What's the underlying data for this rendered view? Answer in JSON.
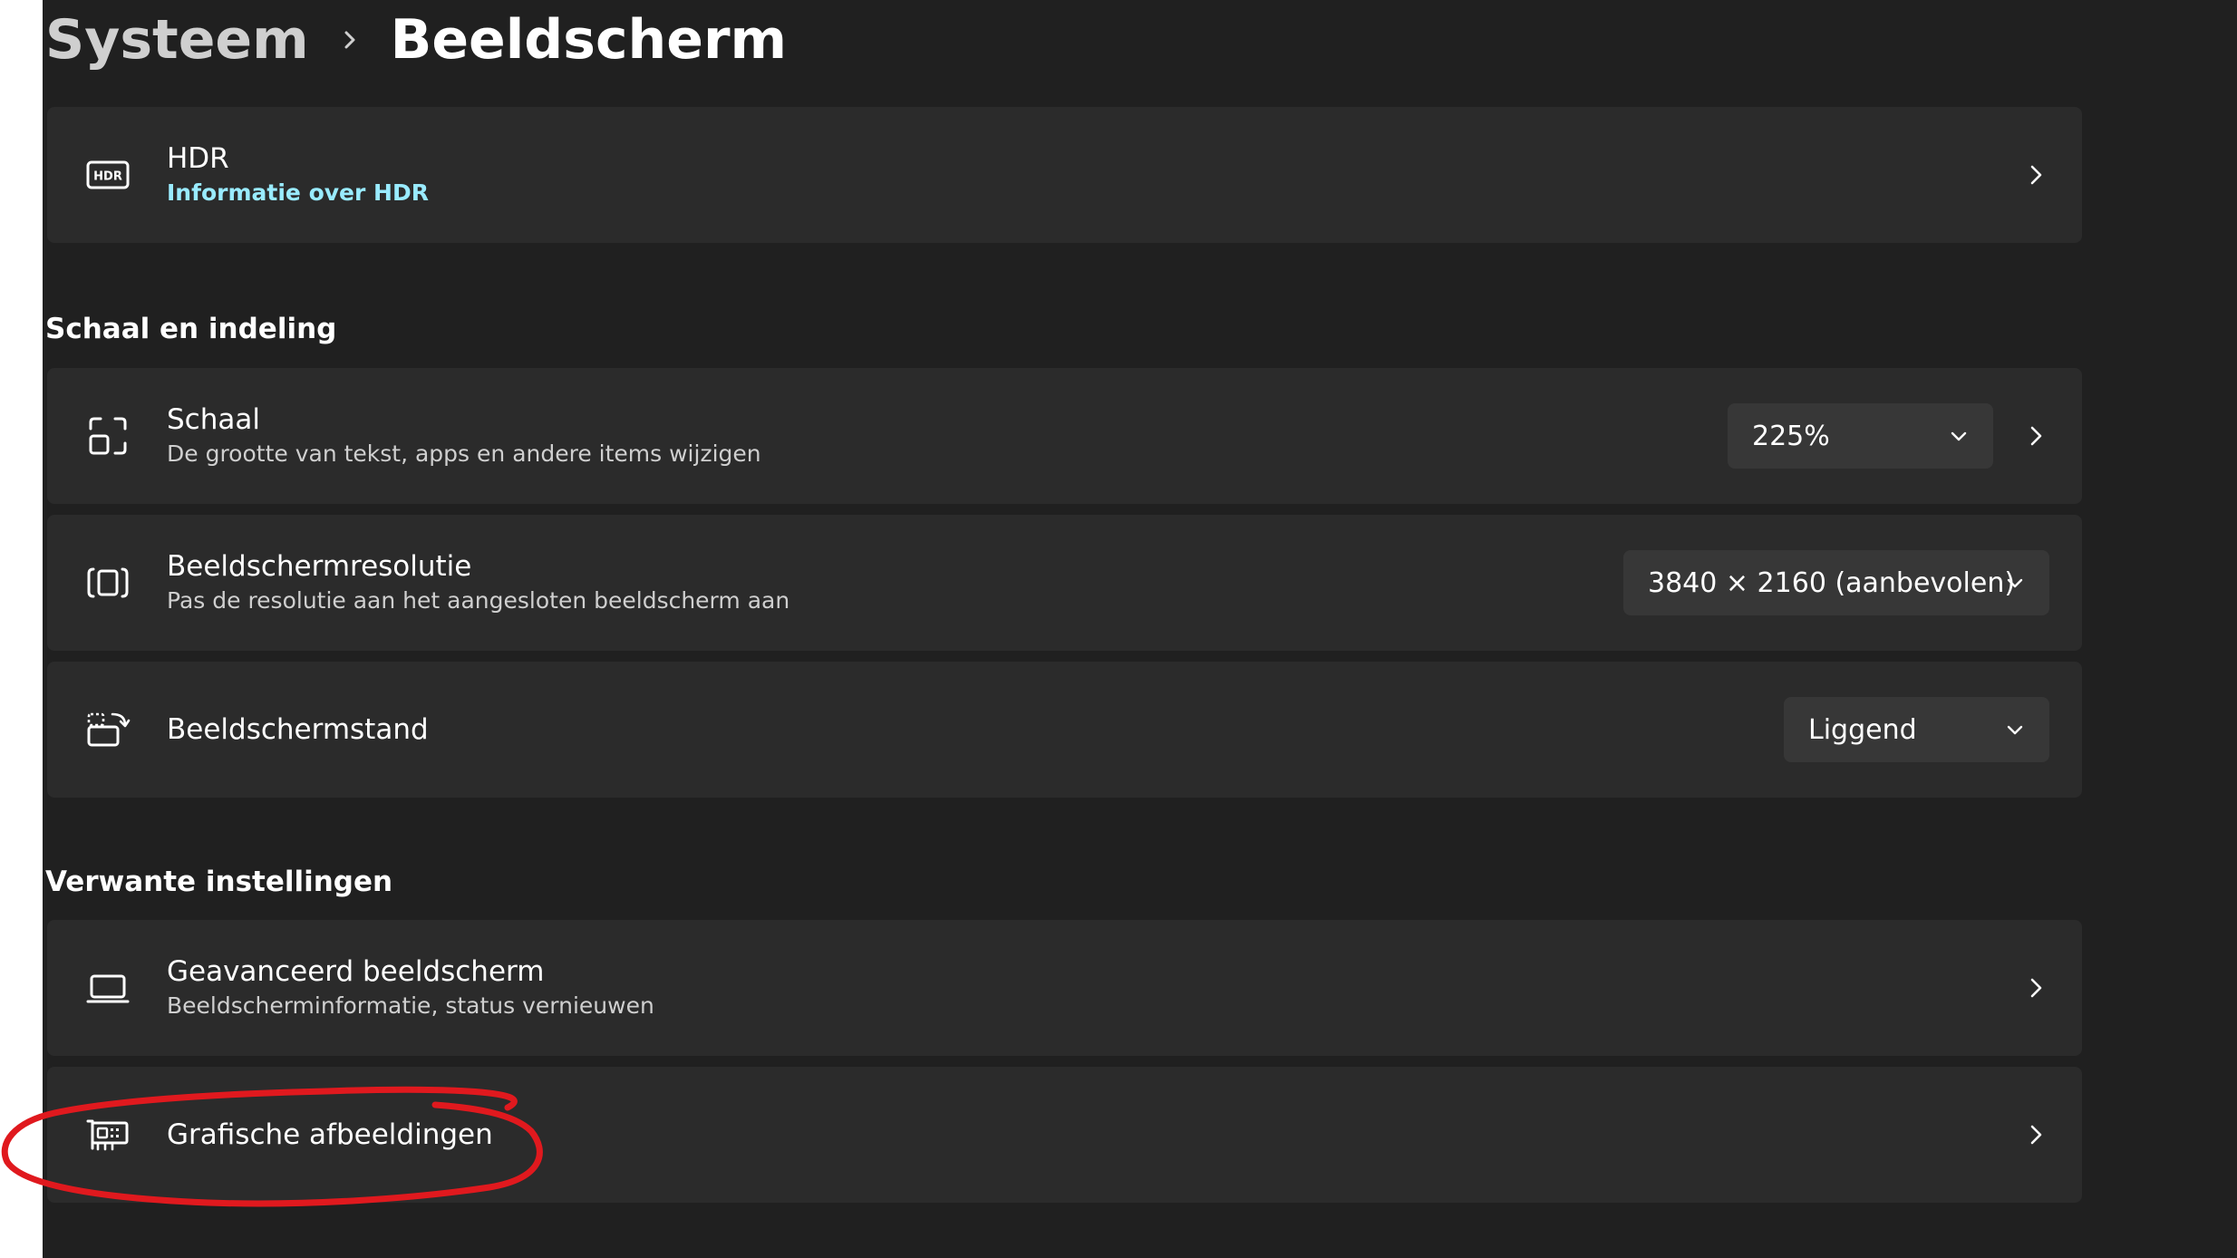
{
  "breadcrumb": {
    "parent": "Systeem",
    "current": "Beeldscherm"
  },
  "hdr": {
    "title": "HDR",
    "link": "Informatie over HDR"
  },
  "sections": {
    "scale_layout": "Schaal en indeling",
    "related": "Verwante instellingen"
  },
  "scale": {
    "title": "Schaal",
    "subtitle": "De grootte van tekst, apps en andere items wijzigen",
    "value": "225%"
  },
  "resolution": {
    "title": "Beeldschermresolutie",
    "subtitle": "Pas de resolutie aan het aangesloten beeldscherm aan",
    "value": "3840 × 2160 (aanbevolen)"
  },
  "orientation": {
    "title": "Beeldschermstand",
    "value": "Liggend"
  },
  "advanced": {
    "title": "Geavanceerd beeldscherm",
    "subtitle": "Beeldscherminformatie, status vernieuwen"
  },
  "graphics": {
    "title": "Grafische afbeeldingen"
  },
  "colors": {
    "background": "#202020",
    "card": "#2b2b2b",
    "dropdown": "#373737",
    "link": "#99ebff",
    "annotation": "#e0191e"
  }
}
